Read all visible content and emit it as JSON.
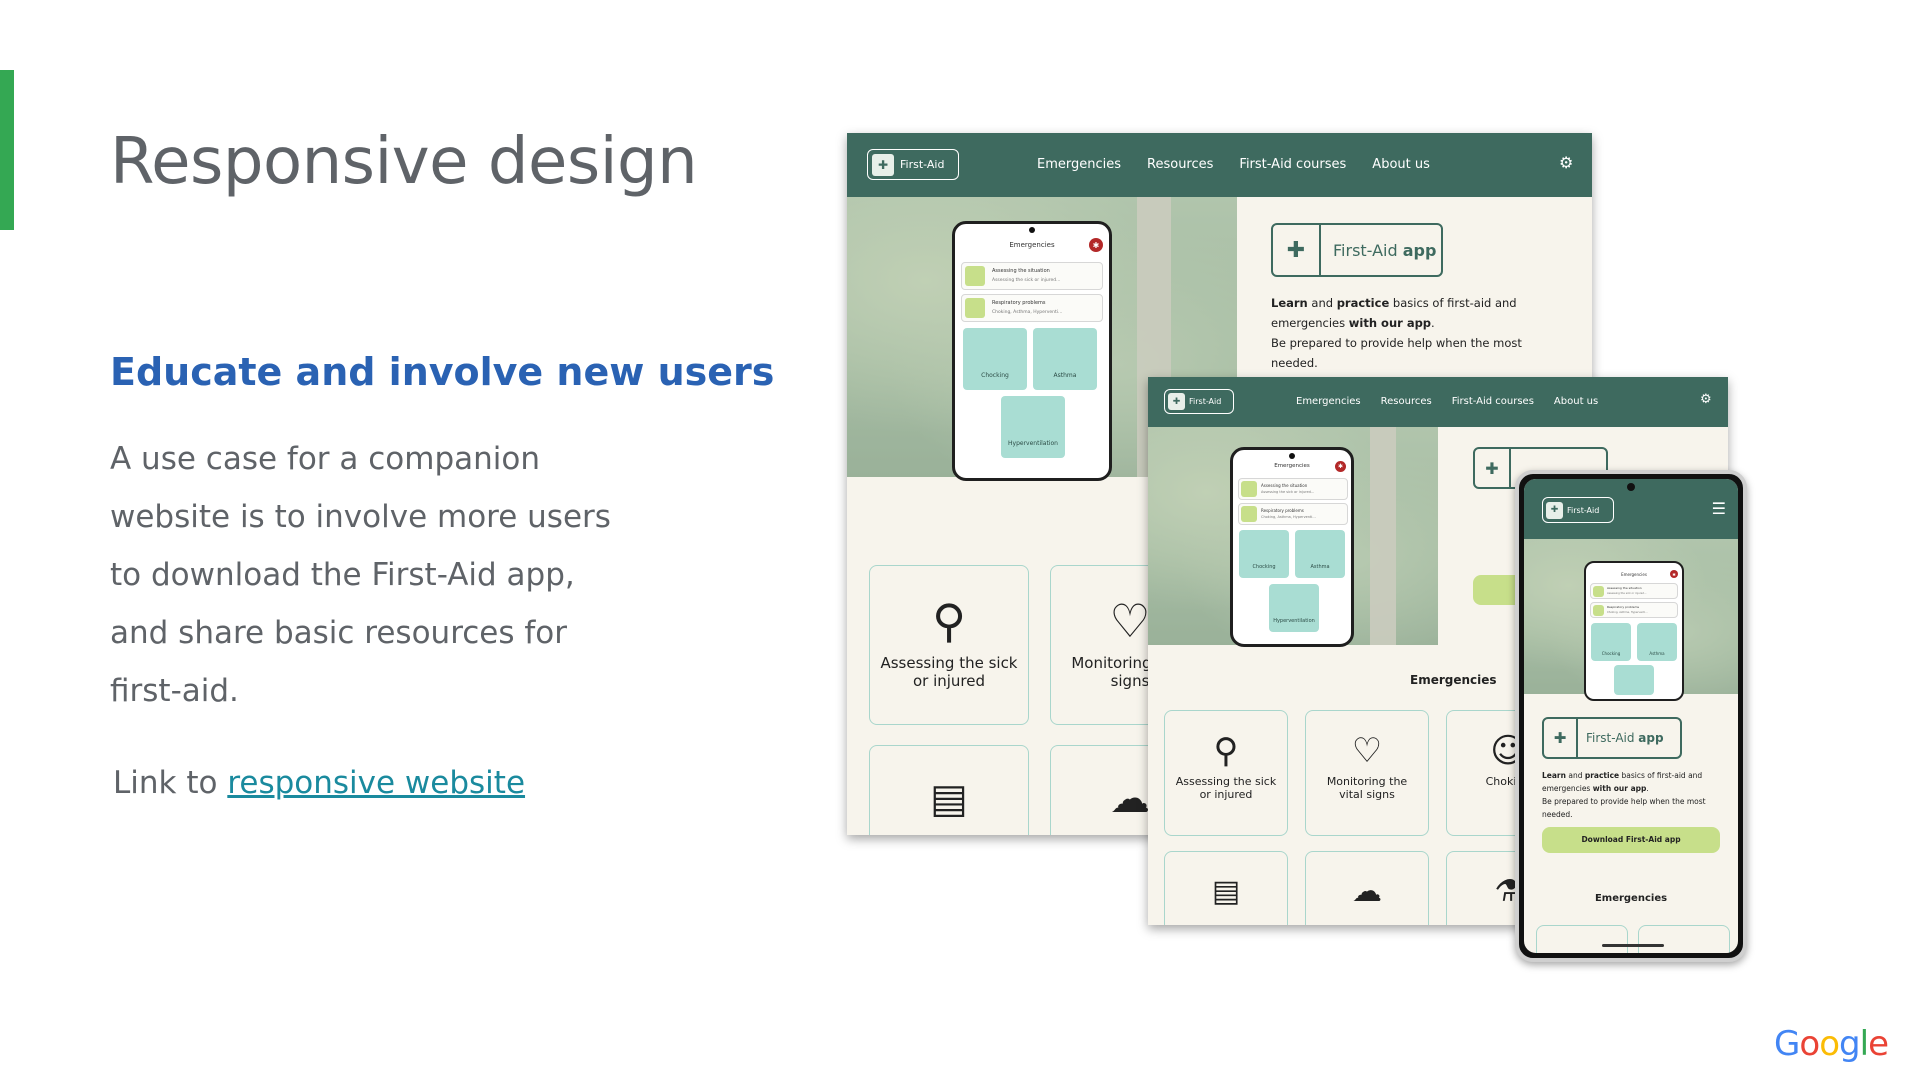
{
  "slide": {
    "title": "Responsive design",
    "subtitle": "Educate and involve new users",
    "body_lines": [
      "A use case for a companion",
      "website is to involve more users",
      "to download the First-Aid app,",
      "and share basic resources for",
      "first-aid."
    ],
    "link_prefix": "Link to ",
    "link_text": "responsive website",
    "brand": "Google"
  },
  "site": {
    "logo_text": "First-Aid",
    "nav": [
      "Emergencies",
      "Resources",
      "First-Aid courses",
      "About us"
    ],
    "app_badge_prefix": "First-Aid ",
    "app_badge_bold": "app",
    "desc": {
      "learn": "Learn",
      "and": " and ",
      "practice": "practice",
      "rest1": " basics of first-aid and emergencies ",
      "with_app": "with our app",
      "period": ".",
      "line2": "Be prepared to provide help when the most needed."
    },
    "download_button": "Download First-Aid app",
    "section_title": "Emergencies",
    "tiles": [
      "Assessing the sick or injured",
      "Monitoring the vital signs",
      "Choking"
    ],
    "tile_partial_large": [
      "Assessing the sick or injured",
      "Monitoring vital signs"
    ]
  },
  "app_screen": {
    "title": "Emergencies",
    "rows": [
      {
        "title": "Assessing the situation",
        "sub": "Assessing the sick or injured..."
      },
      {
        "title": "Respiratory problems",
        "sub": "Choking, Asthma, Hyperventi..."
      }
    ],
    "tiles": [
      "Chocking",
      "Asthma",
      "Hyperventilation"
    ]
  },
  "colors": {
    "accent_bar": "#34a853",
    "nav_green": "#3e6a5f",
    "subtitle_blue": "#2a62b3",
    "link_teal": "#1a8a9e",
    "tile_mint": "#a9ddd3",
    "button_lime": "#c7df8a"
  }
}
